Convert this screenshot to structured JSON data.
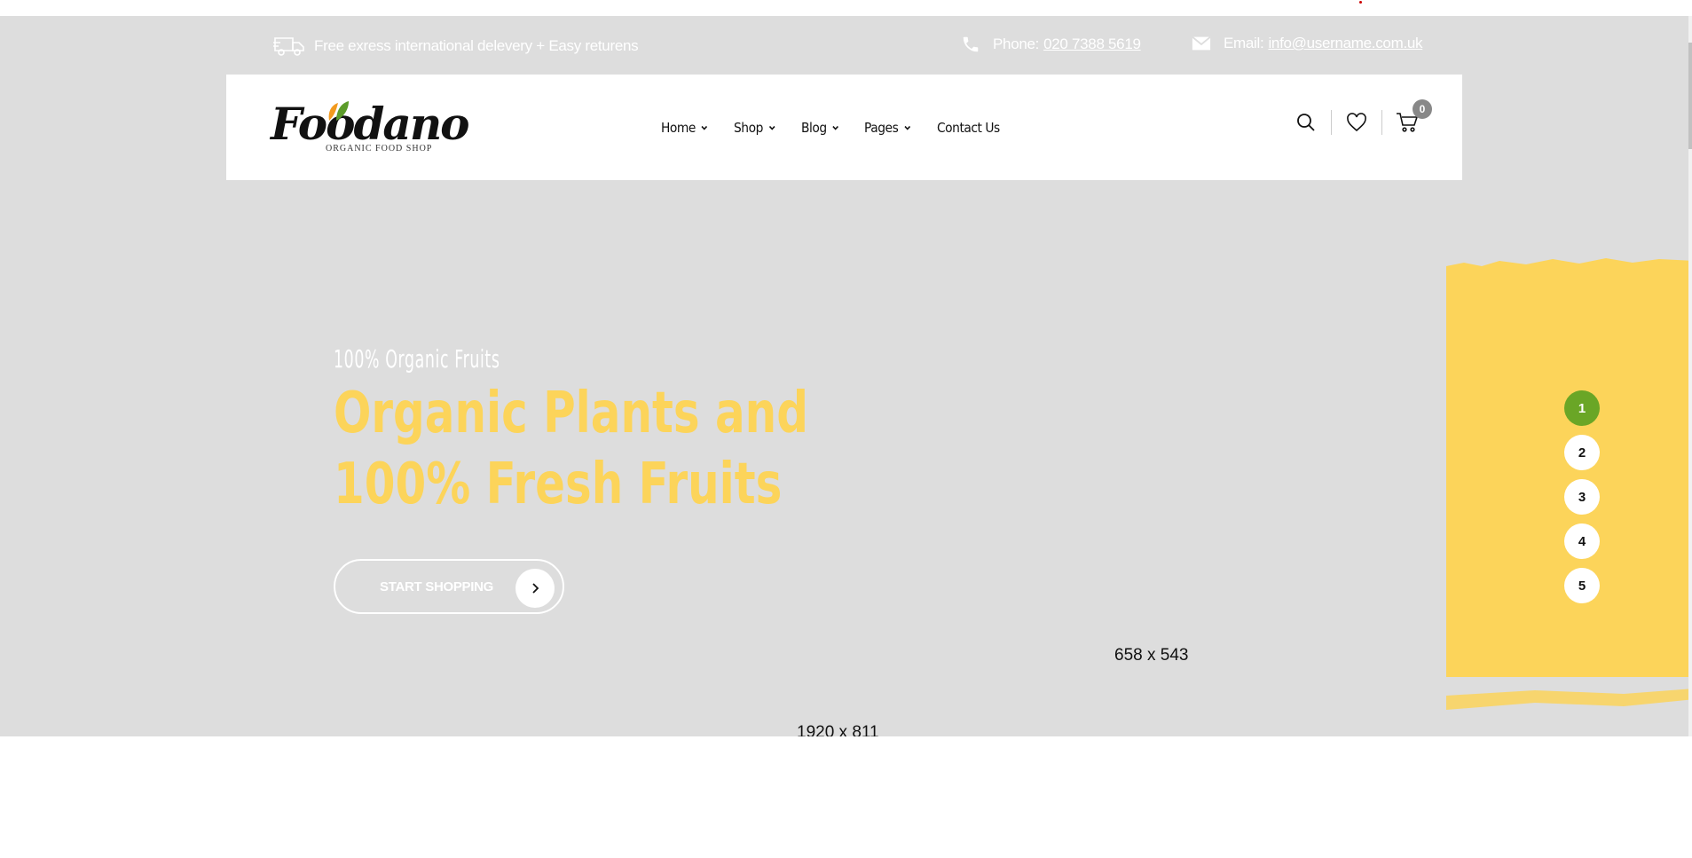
{
  "topbar": {
    "delivery_text": "Free exress international delevery + Easy returens",
    "phone_label": "Phone:",
    "phone_value": "020 7388 5619",
    "email_label": "Email:",
    "email_value": "info@username.com.uk"
  },
  "header": {
    "logo_word": "Foodano",
    "logo_tagline": "ORGANIC FOOD SHOP",
    "nav": [
      "Home",
      "Shop",
      "Blog",
      "Pages",
      "Contact Us"
    ],
    "cart_count": "0"
  },
  "hero": {
    "subtitle": "100% Organic Fruits",
    "title_line1": "Organic Plants and",
    "title_line2": "100% Fresh Fruits",
    "cta_label": "START SHOPPING",
    "image_placeholder_small": "658 x 543",
    "image_placeholder_bg": "1920 x 811",
    "pager": [
      "1",
      "2",
      "3",
      "4",
      "5"
    ],
    "pager_active": "1"
  },
  "colors": {
    "accent_yellow": "#fcd45a",
    "accent_green": "#6aa626",
    "hero_bg": "#dddddd"
  },
  "icons": [
    "delivery-truck-icon",
    "phone-icon",
    "mail-icon",
    "search-icon",
    "heart-icon",
    "cart-icon",
    "chevron-down-icon",
    "chevron-right-icon"
  ]
}
